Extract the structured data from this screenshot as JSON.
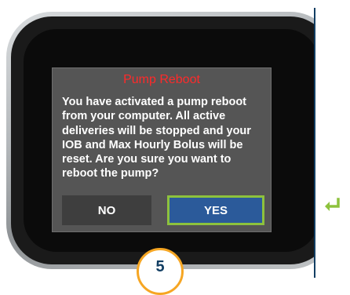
{
  "dialog": {
    "title": "Pump Reboot",
    "lines": [
      "You have activated a pump reboot",
      "from your computer. All active",
      "deliveries will be stopped and your",
      "IOB and Max Hourly Bolus will be",
      "reset. Are you sure you want to",
      "reboot the pump?"
    ],
    "no_label": "NO",
    "yes_label": "YES"
  },
  "step_badge": "5",
  "icons": {
    "side_indicator": "enter-return-icon"
  },
  "colors": {
    "title_red": "#ff2a2a",
    "yes_button": "#2b5a9a",
    "yes_highlight": "#8dc23d",
    "step_ring": "#f6a623",
    "navy": "#123e63"
  }
}
